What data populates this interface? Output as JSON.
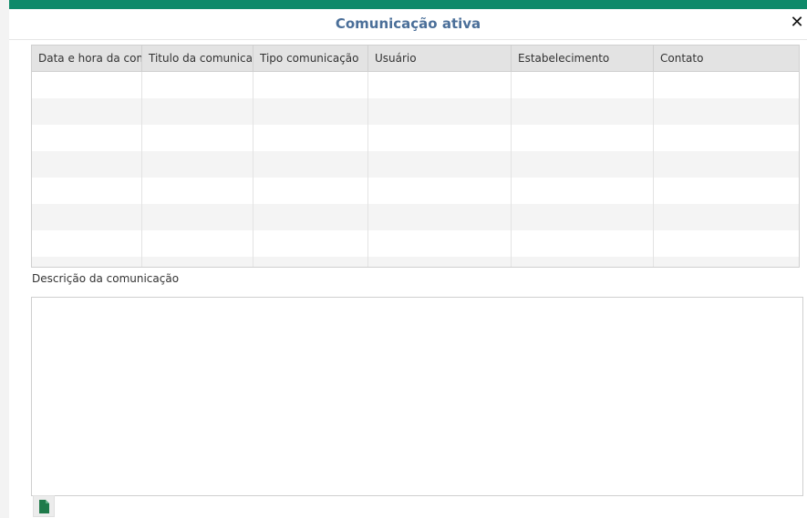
{
  "dialog": {
    "title": "Comunicação ativa",
    "close_glyph": "✕"
  },
  "grid": {
    "columns": [
      "Data e hora da com",
      "Titulo da comunicação",
      "Tipo comunicação",
      "Usuário",
      "Estabelecimento",
      "Contato"
    ],
    "rows": []
  },
  "description": {
    "label": "Descrição da comunicação",
    "value": ""
  },
  "toolbar": {
    "new_document_icon": "document-icon"
  },
  "colors": {
    "accent_strip": "#0f8a6a",
    "title": "#4b6f99",
    "header_bg": "#e3e3e3",
    "icon_green": "#1f7a4a"
  }
}
